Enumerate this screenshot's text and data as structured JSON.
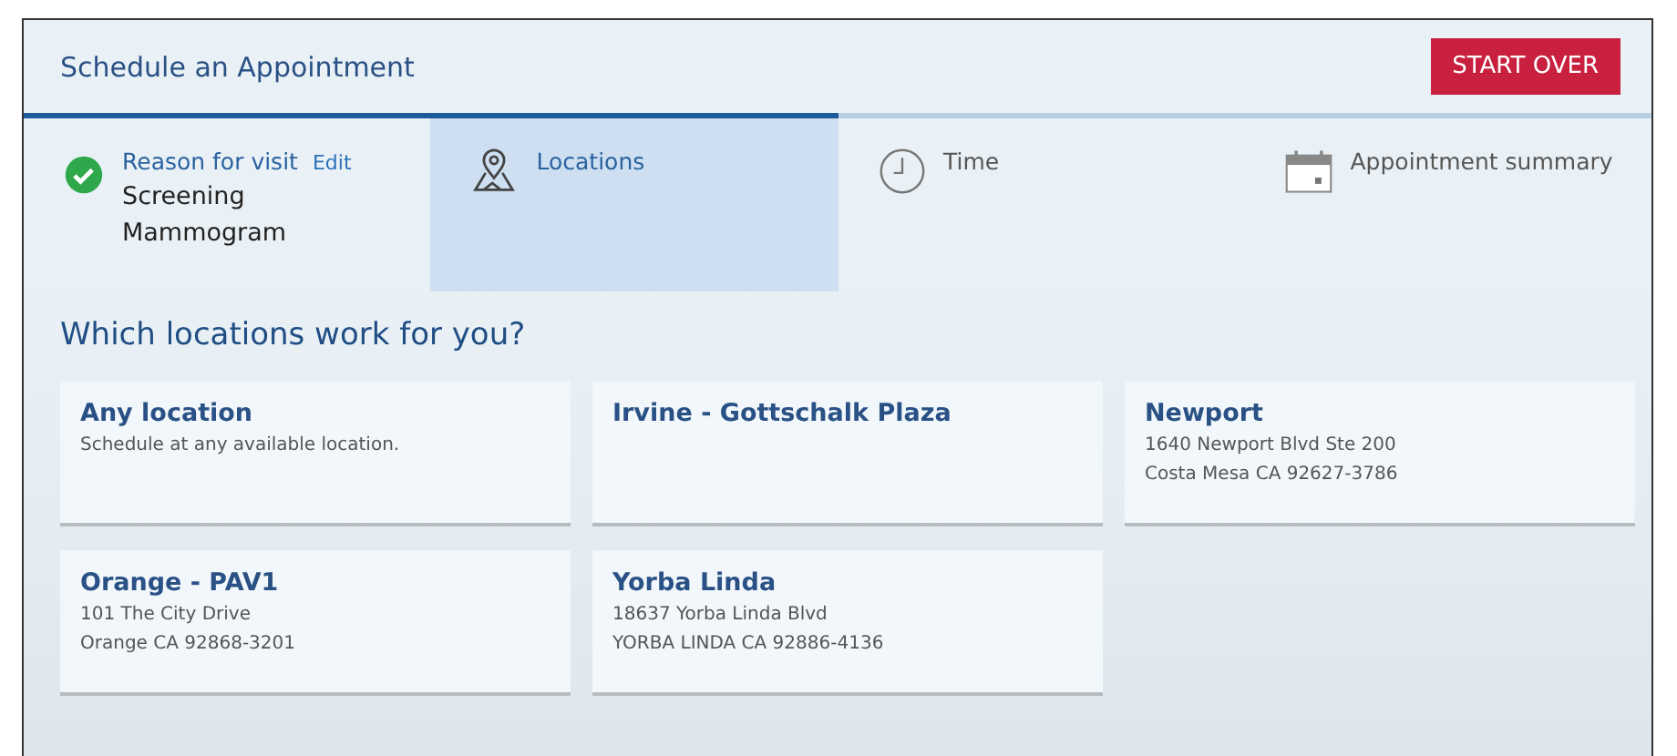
{
  "header": {
    "title": "Schedule an Appointment",
    "button": "START OVER"
  },
  "steps": [
    {
      "kind": "check",
      "label": "Reason for visit",
      "edit": "Edit",
      "value": "Screening Mammogram",
      "done": true,
      "selected": false
    },
    {
      "kind": "map",
      "label": "Locations",
      "done": false,
      "selected": true
    },
    {
      "kind": "clock",
      "label": "Time",
      "done": false,
      "selected": false
    },
    {
      "kind": "calendar",
      "label": "Appointment summary",
      "done": false,
      "selected": false
    }
  ],
  "heading": "Which locations work for you?",
  "locations": [
    {
      "name": "Any location",
      "lines": [
        "Schedule at any available location."
      ]
    },
    {
      "name": "Irvine - Gottschalk Plaza"
    },
    {
      "name": "Newport",
      "lines": [
        "1640 Newport Blvd Ste 200",
        "Costa Mesa CA 92627-3786"
      ]
    },
    {
      "name": "Orange - PAV1",
      "lines": [
        "101 The City Drive",
        "Orange CA 92868-3201"
      ]
    },
    {
      "name": "Yorba Linda",
      "lines": [
        "18637 Yorba Linda Blvd",
        "YORBA LINDA CA 92886-4136"
      ]
    }
  ]
}
